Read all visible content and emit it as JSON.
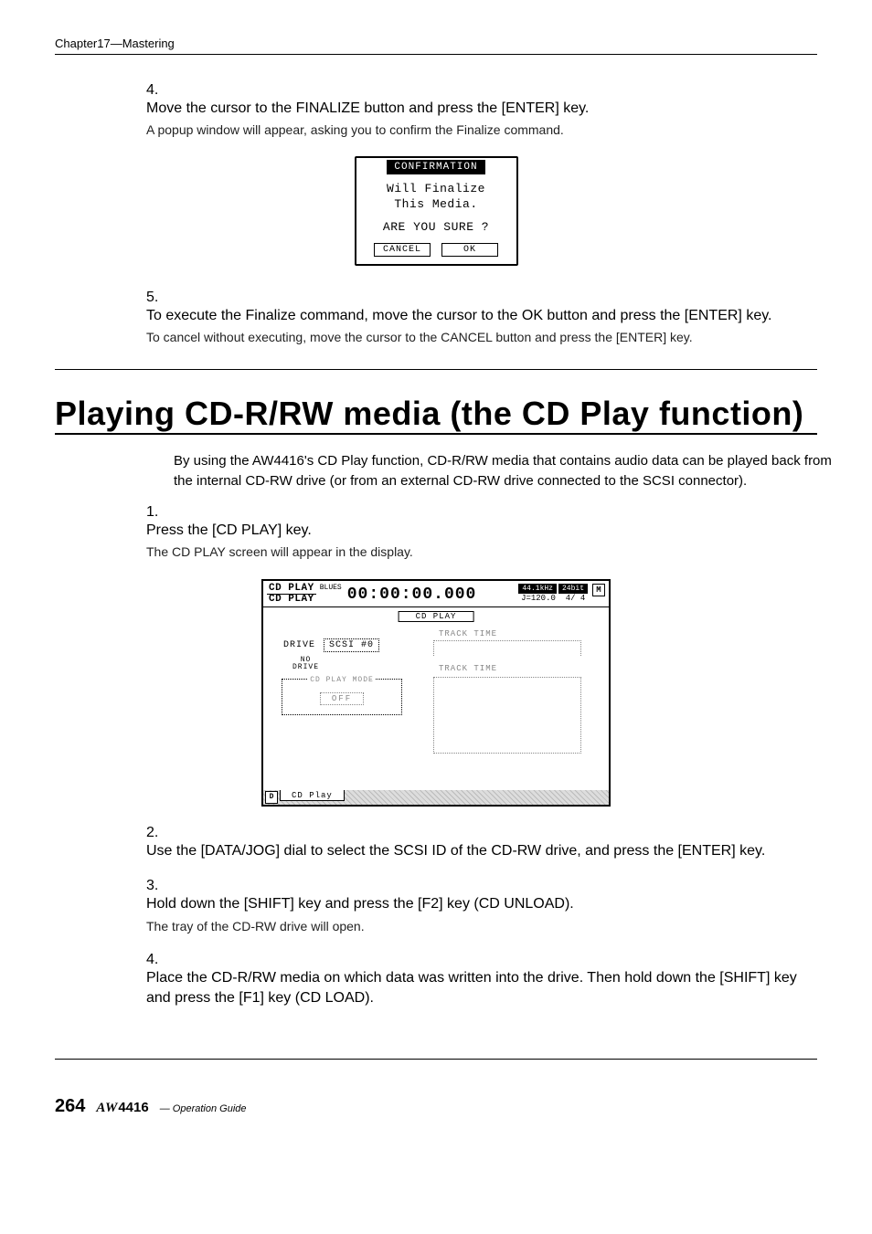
{
  "header": {
    "chapter": "Chapter17—Mastering"
  },
  "steps_a": [
    {
      "num": "4.",
      "head": "Move the cursor to the FINALIZE button and press the [ENTER] key.",
      "sub": "A popup window will appear, asking you to confirm the Finalize command."
    },
    {
      "num": "5.",
      "head": "To execute the Finalize command, move the cursor to the OK button and press the [ENTER] key.",
      "sub": "To cancel without executing, move the cursor to the CANCEL button and press the [ENTER] key."
    }
  ],
  "dialog": {
    "title": "CONFIRMATION",
    "line1": "Will Finalize",
    "line2": "This Media.",
    "line3": "ARE YOU SURE ?",
    "cancel": "CANCEL",
    "ok": "OK"
  },
  "section_title": "Playing CD-R/RW media (the CD Play function)",
  "intro": "By using the AW4416's CD Play function, CD-R/RW media that contains audio data can be played back from the internal CD-RW drive (or from an external CD-RW drive connected to the SCSI connector).",
  "steps_b": [
    {
      "num": "1.",
      "head": "Press the [CD PLAY] key.",
      "sub": "The CD PLAY screen will appear in the display."
    },
    {
      "num": "2.",
      "head": "Use the [DATA/JOG] dial to select the SCSI ID of the CD-RW drive, and press the [ENTER] key.",
      "sub": ""
    },
    {
      "num": "3.",
      "head": "Hold down the [SHIFT] key and press the [F2] key (CD UNLOAD).",
      "sub": "The tray of the CD-RW drive will open."
    },
    {
      "num": "4.",
      "head": "Place the CD-R/RW media on which data was written into the drive. Then hold down the [SHIFT] key and press the [F1] key (CD LOAD).",
      "sub": ""
    }
  ],
  "lcd": {
    "screen1": "CD PLAY",
    "screen2": "CD PLAY",
    "song": "BLUES",
    "timecode": "00:00:00.000",
    "rate": "44.1kHz",
    "bit": "24bit",
    "tempo": "J=120.0",
    "sig": "4/ 4",
    "m": "M",
    "tab": "CD PLAY",
    "drive": "DRIVE",
    "scsi": "SCSI #0",
    "no": "NO",
    "no2": "DRIVE",
    "mode_title": "CD PLAY MODE",
    "off": "OFF",
    "track1": "TRACK   TIME",
    "track2": "TRACK   TIME",
    "footer_tab": "CD Play",
    "doc": "D"
  },
  "footer": {
    "page": "264",
    "logoA": "AW",
    "logoB": "4416",
    "guide": "— Operation Guide"
  }
}
